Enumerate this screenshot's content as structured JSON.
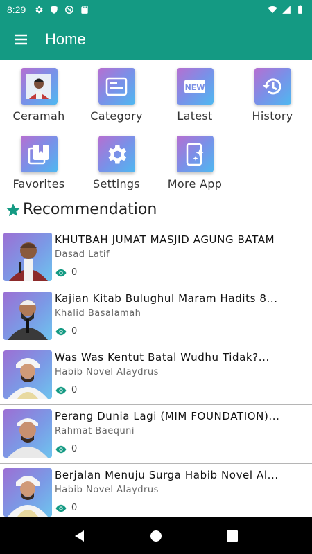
{
  "status": {
    "time": "8:29",
    "left_icons": [
      "gear-icon",
      "shield-icon",
      "no-sync-icon",
      "sd-card-icon"
    ],
    "right_icons": [
      "wifi-icon",
      "signal-icon",
      "battery-icon"
    ]
  },
  "app_bar": {
    "title": "Home",
    "menu_icon": "hamburger-icon",
    "background": "#149a83"
  },
  "grid": [
    {
      "label": "Ceramah",
      "icon": "speaker-photo-icon"
    },
    {
      "label": "Category",
      "icon": "category-icon"
    },
    {
      "label": "Latest",
      "icon": "new-badge-icon"
    },
    {
      "label": "History",
      "icon": "history-icon"
    },
    {
      "label": "Favorites",
      "icon": "bookmark-icon"
    },
    {
      "label": "Settings",
      "icon": "settings-icon"
    },
    {
      "label": "More App",
      "icon": "more-app-icon"
    }
  ],
  "section": {
    "title": "Recommendation",
    "icon": "star-icon",
    "accent": "#149a83"
  },
  "videos": [
    {
      "title": "KHUTBAH JUMAT MASJID AGUNG BATAM",
      "author": "Dasad Latif",
      "views": "0"
    },
    {
      "title": "Kajian Kitab Bulughul Maram Hadits 8...",
      "author": "Khalid Basalamah",
      "views": "0"
    },
    {
      "title": "Was Was Kentut Batal Wudhu Tidak?...",
      "author": "Habib Novel Alaydrus",
      "views": "0"
    },
    {
      "title": "Perang Dunia Lagi (MIM FOUNDATION)...",
      "author": "Rahmat Baequni",
      "views": "0"
    },
    {
      "title": "Berjalan Menuju Surga Habib Novel Al...",
      "author": "Habib Novel Alaydrus",
      "views": "0"
    }
  ],
  "nav": {
    "back_icon": "back-triangle-icon",
    "home_icon": "home-circle-icon",
    "recents_icon": "recents-square-icon"
  }
}
